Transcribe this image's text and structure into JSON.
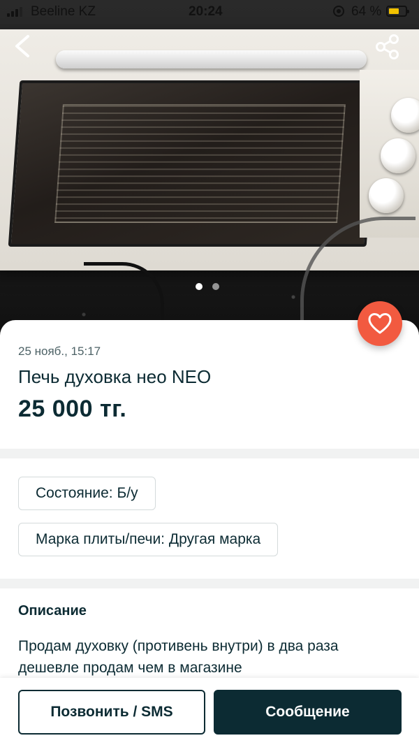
{
  "status_bar": {
    "carrier": "Beeline KZ",
    "time": "20:24",
    "battery_percent": "64 %",
    "battery_level": 0.64
  },
  "gallery": {
    "image_count": 2,
    "active_index": 0
  },
  "listing": {
    "date": "25 нояб., 15:17",
    "title": "Печь духовка нео NEO",
    "price": "25 000 тг."
  },
  "attributes": [
    "Состояние: Б/у",
    "Марка плиты/печи: Другая марка"
  ],
  "description": {
    "heading": "Описание",
    "text": "Продам духовку (противень внутри) в два раза дешевле продам чем в магазине"
  },
  "actions": {
    "call_label": "Позвонить / SMS",
    "message_label": "Сообщение"
  },
  "colors": {
    "primary": "#0c2b33",
    "favorite": "#f25a40"
  },
  "icons": [
    "back-arrow-icon",
    "share-icon",
    "heart-icon"
  ]
}
